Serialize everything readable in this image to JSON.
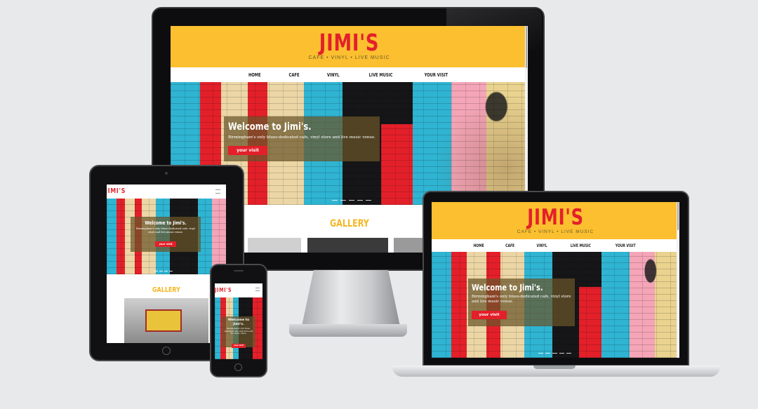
{
  "site": {
    "logo": "JIMI'S",
    "tagline": "CAFE  •  VINYL  •  LIVE  MUSIC",
    "nav": [
      "HOME",
      "CAFE",
      "VINYL",
      "LIVE MUSIC",
      "YOUR VISIT"
    ],
    "hero_title": "Welcome to Jimi's.",
    "hero_sub": "Birmingham's only blues-dedicated cafe, vinyl store and live music venue.",
    "cta": "your visit",
    "gallery_title": "GALLERY",
    "tablet_sub": "Birmingham's only blues-dedicated cafe, vinyl store and live music venue.",
    "phone_sub": "Birmingham's only blues-dedicated cafe, vinyl store and live music venue."
  },
  "colors": {
    "brand_yellow": "#fbbf2f",
    "brand_red": "#e3202a",
    "stripe_cyan": "#2fb4d2",
    "stripe_cream": "#ecd6a6"
  }
}
